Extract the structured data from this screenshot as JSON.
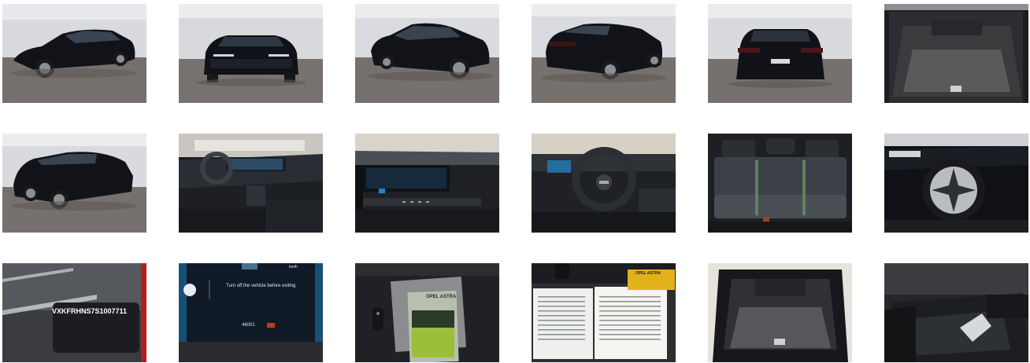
{
  "gallery": {
    "rows": [
      {
        "items": [
          {
            "subject": "exterior-front-left-three-quarter"
          },
          {
            "subject": "exterior-front"
          },
          {
            "subject": "exterior-front-right-three-quarter"
          },
          {
            "subject": "exterior-rear-left-three-quarter"
          },
          {
            "subject": "exterior-rear"
          },
          {
            "subject": "boot-interior"
          }
        ]
      },
      {
        "items": [
          {
            "subject": "exterior-rear-left-side"
          },
          {
            "subject": "dashboard-wide"
          },
          {
            "subject": "dashboard-center-screen"
          },
          {
            "subject": "steering-wheel-cockpit"
          },
          {
            "subject": "rear-seats"
          },
          {
            "subject": "front-wheel-alloy"
          }
        ]
      },
      {
        "items": [
          {
            "subject": "vin-plate",
            "text": "VXKFRHNS7S1007711"
          },
          {
            "subject": "instrument-cluster",
            "message": "Turn off the vehicle before exiting",
            "odometer": "46001",
            "unit": "km/h"
          },
          {
            "subject": "keys-and-manuals",
            "booklet_label": "OPEL ASTRA"
          },
          {
            "subject": "service-booklet-open",
            "booklet_label": "OPEL ASTRA"
          },
          {
            "subject": "boot-open-rear"
          },
          {
            "subject": "boot-underfloor-storage"
          }
        ]
      }
    ]
  },
  "colors": {
    "studio_wall": "#d7d8dc",
    "studio_floor": "#75706e",
    "car_body": "#0f1115",
    "interior_dark": "#22252a",
    "screen_blue": "#1f86c8"
  }
}
